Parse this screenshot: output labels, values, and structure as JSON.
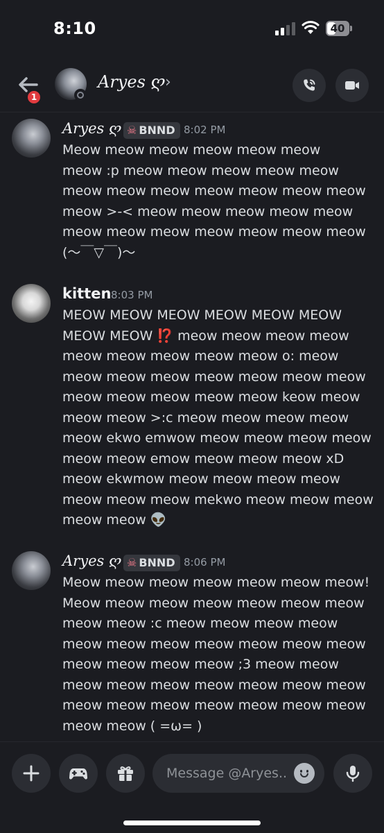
{
  "status_bar": {
    "time": "8:10",
    "battery": "40",
    "battery_level": 0.4
  },
  "header": {
    "back_badge": "1",
    "name": "Aryes ღ",
    "chevron": "›",
    "status": "offline"
  },
  "messages": [
    {
      "author": "Aryes ღ",
      "tag": "BNND",
      "time": "8:02 PM",
      "lines": [
        "Meow meow meow meow meow meow",
        "meow :p meow meow meow meow meow",
        "meow meow meow meow meow meow meow",
        "meow >-< meow meow meow meow meow",
        "meow meow meow meow meow meow meow",
        "(～￣▽￣)～"
      ]
    },
    {
      "author": "kitten",
      "time": "8:03 PM",
      "lines": [
        "MEOW MEOW MEOW MEOW MEOW MEOW",
        "MEOW MEOW",
        "meow meow meow meow",
        "meow meow meow meow meow o: meow",
        "meow meow meow meow meow meow meow",
        "meow meow meow meow meow keow meow",
        "meow meow >:c meow meow meow meow",
        "meow ekwo emwow meow meow meow meow",
        "meow meow emow meow meow meow xD",
        "meow ekwmow meow meow meow meow",
        "meow meow meow mekwo meow meow meow",
        "meow meow 👽"
      ],
      "inline_emoji": "⁉️"
    },
    {
      "author": "Aryes ღ",
      "tag": "BNND",
      "time": "8:06 PM",
      "lines": [
        "Meow meow meow meow meow meow meow!",
        "Meow meow meow meow meow meow meow",
        "meow meow :c meow meow meow meow",
        "meow meow meow meow meow meow meow",
        "meow meow meow meow ;3 meow meow",
        "meow meow meow meow meow meow meow",
        "meow meow meow meow meow meow meow",
        "meow meow ( =ω= )"
      ]
    }
  ],
  "composer": {
    "placeholder": "Message @Aryes.."
  },
  "icons": {
    "back": "arrow-left-icon",
    "call": "phone-icon",
    "video": "video-camera-icon",
    "plus": "plus-icon",
    "game": "gamepad-icon",
    "gift": "gift-icon",
    "emoji": "smiley-icon",
    "mic": "microphone-icon",
    "tag": "skull-icon"
  },
  "colors": {
    "background": "#1b1c21",
    "surface": "#2b2d33",
    "badge": "#e23b3f",
    "muted": "#949ba4"
  }
}
